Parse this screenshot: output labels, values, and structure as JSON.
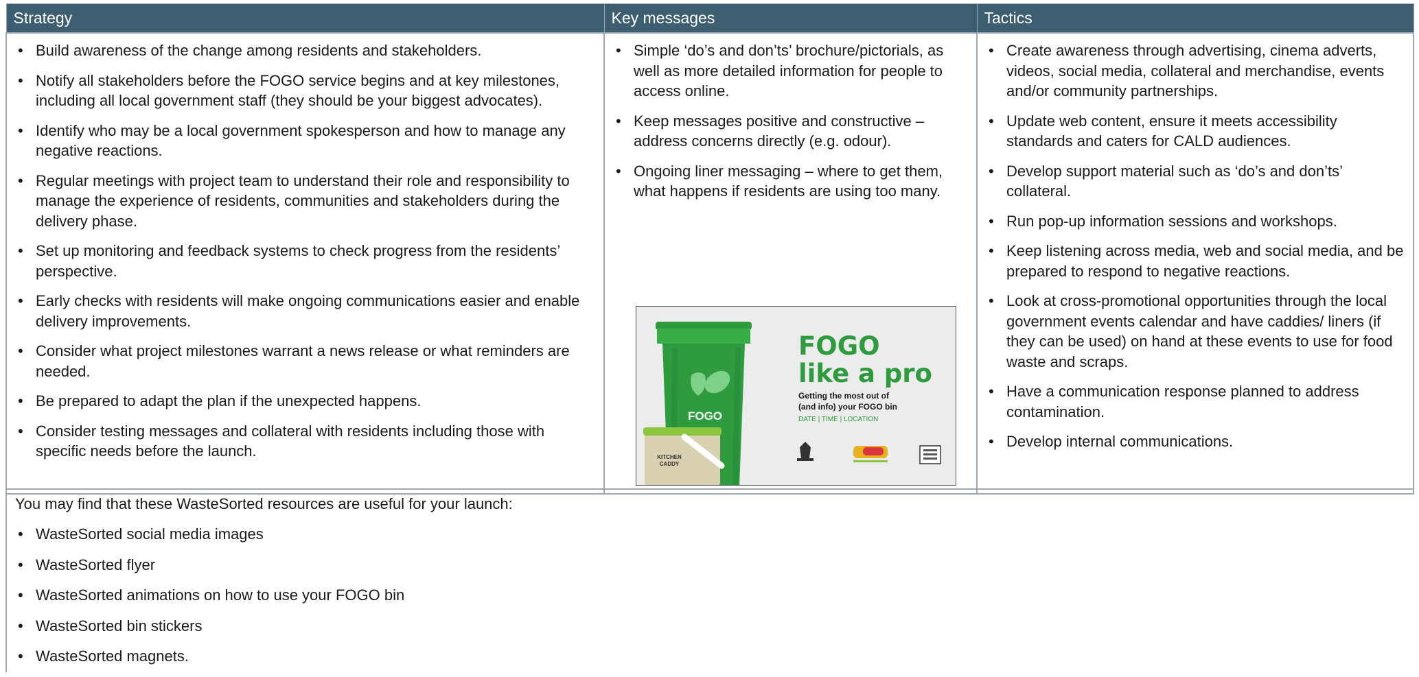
{
  "table": {
    "headers": [
      "Strategy",
      "Key messages",
      "Tactics"
    ],
    "strategy": [
      "Build awareness of the change among residents and stakeholders.",
      "Notify all stakeholders before the FOGO service begins and at key milestones, including all local government staff (they should be your biggest advocates).",
      "Identify who may be a local government spokesperson and how to manage any negative reactions.",
      "Regular meetings with project team to understand their role and responsibility to manage the experience of residents, communities and stakeholders during the delivery phase.",
      "Set up monitoring and feedback systems to check progress from the residents’ perspective.",
      "Early checks with residents will make ongoing communications easier and enable delivery improvements.",
      "Consider what project milestones warrant a news release or what reminders are needed.",
      "Be prepared to adapt the plan if the unexpected happens.",
      "Consider testing messages and collateral with residents including those with specific needs before the launch."
    ],
    "key_messages": [
      "Simple ‘do’s and don’ts’ brochure/pictorials, as well as more detailed information for people to access online.",
      "Keep messages positive and constructive – address concerns directly (e.g. odour).",
      "Ongoing liner messaging – where to get them, what happens if residents are using too many."
    ],
    "tactics": [
      "Create awareness through advertising, cinema adverts, videos, social media, collateral and merchandise, events and/or community partnerships.",
      "Update web content, ensure it meets accessibility standards and caters for CALD audiences.",
      "Develop support material such as ‘do’s and don’ts’ collateral.",
      "Run pop-up information sessions and workshops.",
      "Keep listening across media, web and social media, and be prepared to respond to negative reactions.",
      "Look at cross-promotional opportunities through the local government events calendar and have caddies/ liners (if they can be used) on hand at these events to use for food waste and scraps.",
      "Have a communication response planned to address contamination.",
      "Develop internal communications."
    ]
  },
  "promo": {
    "headline_1": "FOGO",
    "headline_2": "like a pro",
    "sub_1": "Getting the most out of",
    "sub_2": "(and info) your FOGO bin",
    "details": "DATE | TIME | LOCATION",
    "bin_label": "FOGO",
    "caddy_label_1": "KITCHEN",
    "caddy_label_2": "CADDY",
    "colors": {
      "green": "#2e9b3e",
      "dark_green": "#1f7a2e",
      "bg": "#ececec"
    }
  },
  "footer": {
    "intro": "You may find that these WasteSorted resources are useful for your launch:",
    "resources": [
      "WasteSorted social media images",
      "WasteSorted flyer",
      "WasteSorted animations on how to use your FOGO bin",
      "WasteSorted bin stickers",
      "WasteSorted magnets."
    ]
  },
  "colors": {
    "header_bg": "#3d5d70",
    "header_text": "#ffffff",
    "border": "#9aa7b0"
  }
}
